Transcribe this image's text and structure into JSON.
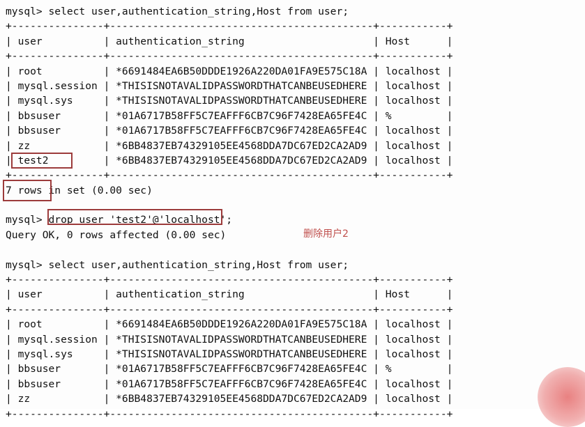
{
  "terminal": {
    "prompt": "mysql> ",
    "lines": [
      {
        "id": "l0",
        "text": "mysql> select user,authentication_string,Host from user;"
      },
      {
        "id": "l1",
        "text": "+---------------+-------------------------------------------+-----------+"
      },
      {
        "id": "l2",
        "text": "| user          | authentication_string                     | Host      |"
      },
      {
        "id": "l3",
        "text": "+---------------+-------------------------------------------+-----------+"
      },
      {
        "id": "l4",
        "text": "| root          | *6691484EA6B50DDDE1926A220DA01FA9E575C18A | localhost |"
      },
      {
        "id": "l5",
        "text": "| mysql.session | *THISISNOTAVALIDPASSWORDTHATCANBEUSEDHERE | localhost |"
      },
      {
        "id": "l6",
        "text": "| mysql.sys     | *THISISNOTAVALIDPASSWORDTHATCANBEUSEDHERE | localhost |"
      },
      {
        "id": "l7",
        "text": "| bbsuser       | *01A6717B58FF5C7EAFFF6CB7C96F7428EA65FE4C | %         |"
      },
      {
        "id": "l8",
        "text": "| bbsuser       | *01A6717B58FF5C7EAFFF6CB7C96F7428EA65FE4C | localhost |"
      },
      {
        "id": "l9",
        "text": "| zz            | *6BB4837EB74329105EE4568DDA7DC67ED2CA2AD9 | localhost |"
      },
      {
        "id": "l10",
        "text": "| test2         | *6BB4837EB74329105EE4568DDA7DC67ED2CA2AD9 | localhost |"
      },
      {
        "id": "l11",
        "text": "+---------------+-------------------------------------------+-----------+"
      },
      {
        "id": "l12",
        "text": "7 rows in set (0.00 sec)"
      },
      {
        "id": "l13",
        "text": ""
      },
      {
        "id": "l14",
        "text": "mysql> drop user 'test2'@'localhost';"
      },
      {
        "id": "l15",
        "text": "Query OK, 0 rows affected (0.00 sec)"
      },
      {
        "id": "l16",
        "text": ""
      },
      {
        "id": "l17",
        "text": "mysql> select user,authentication_string,Host from user;"
      },
      {
        "id": "l18",
        "text": "+---------------+-------------------------------------------+-----------+"
      },
      {
        "id": "l19",
        "text": "| user          | authentication_string                     | Host      |"
      },
      {
        "id": "l20",
        "text": "+---------------+-------------------------------------------+-----------+"
      },
      {
        "id": "l21",
        "text": "| root          | *6691484EA6B50DDDE1926A220DA01FA9E575C18A | localhost |"
      },
      {
        "id": "l22",
        "text": "| mysql.session | *THISISNOTAVALIDPASSWORDTHATCANBEUSEDHERE | localhost |"
      },
      {
        "id": "l23",
        "text": "| mysql.sys     | *THISISNOTAVALIDPASSWORDTHATCANBEUSEDHERE | localhost |"
      },
      {
        "id": "l24",
        "text": "| bbsuser       | *01A6717B58FF5C7EAFFF6CB7C96F7428EA65FE4C | %         |"
      },
      {
        "id": "l25",
        "text": "| bbsuser       | *01A6717B58FF5C7EAFFF6CB7C96F7428EA65FE4C | localhost |"
      },
      {
        "id": "l26",
        "text": "| zz            | *6BB4837EB74329105EE4568DDA7DC67ED2CA2AD9 | localhost |"
      },
      {
        "id": "l27",
        "text": "+---------------+-------------------------------------------+-----------+"
      }
    ]
  },
  "queries": {
    "select_statement": "select user,authentication_string,Host from user;",
    "drop_statement": "drop user 'test2'@'localhost';"
  },
  "results": {
    "first_row_count": "7 rows in set (0.00 sec)",
    "drop_result": "Query OK, 0 rows affected (0.00 sec)"
  },
  "table": {
    "columns": [
      "user",
      "authentication_string",
      "Host"
    ],
    "rows_before": [
      [
        "root",
        "*6691484EA6B50DDDE1926A220DA01FA9E575C18A",
        "localhost"
      ],
      [
        "mysql.session",
        "*THISISNOTAVALIDPASSWORDTHATCANBEUSEDHERE",
        "localhost"
      ],
      [
        "mysql.sys",
        "*THISISNOTAVALIDPASSWORDTHATCANBEUSEDHERE",
        "localhost"
      ],
      [
        "bbsuser",
        "*01A6717B58FF5C7EAFFF6CB7C96F7428EA65FE4C",
        "%"
      ],
      [
        "bbsuser",
        "*01A6717B58FF5C7EAFFF6CB7C96F7428EA65FE4C",
        "localhost"
      ],
      [
        "zz",
        "*6BB4837EB74329105EE4568DDA7DC67ED2CA2AD9",
        "localhost"
      ],
      [
        "test2",
        "*6BB4837EB74329105EE4568DDA7DC67ED2CA2AD9",
        "localhost"
      ]
    ],
    "rows_after": [
      [
        "root",
        "*6691484EA6B50DDDE1926A220DA01FA9E575C18A",
        "localhost"
      ],
      [
        "mysql.session",
        "*THISISNOTAVALIDPASSWORDTHATCANBEUSEDHERE",
        "localhost"
      ],
      [
        "mysql.sys",
        "*THISISNOTAVALIDPASSWORDTHATCANBEUSEDHERE",
        "localhost"
      ],
      [
        "bbsuser",
        "*01A6717B58FF5C7EAFFF6CB7C96F7428EA65FE4C",
        "%"
      ],
      [
        "bbsuser",
        "*01A6717B58FF5C7EAFFF6CB7C96F7428EA65FE4C",
        "localhost"
      ],
      [
        "zz",
        "*6BB4837EB74329105EE4568DDA7DC67ED2CA2AD9",
        "localhost"
      ]
    ]
  },
  "annotations": {
    "note_text": "删除用户2",
    "note_color": "#c0504d",
    "highlight_color": "#9c3b3b",
    "highlighted_user": "test2",
    "highlighted_rowcount": "7 rows",
    "highlighted_command": "drop user 'test2'@'localhost';"
  },
  "colors": {
    "background": "#fdfdfd",
    "text": "#101010",
    "annotation_red": "#c0504d",
    "box_red": "#9c3b3b"
  }
}
